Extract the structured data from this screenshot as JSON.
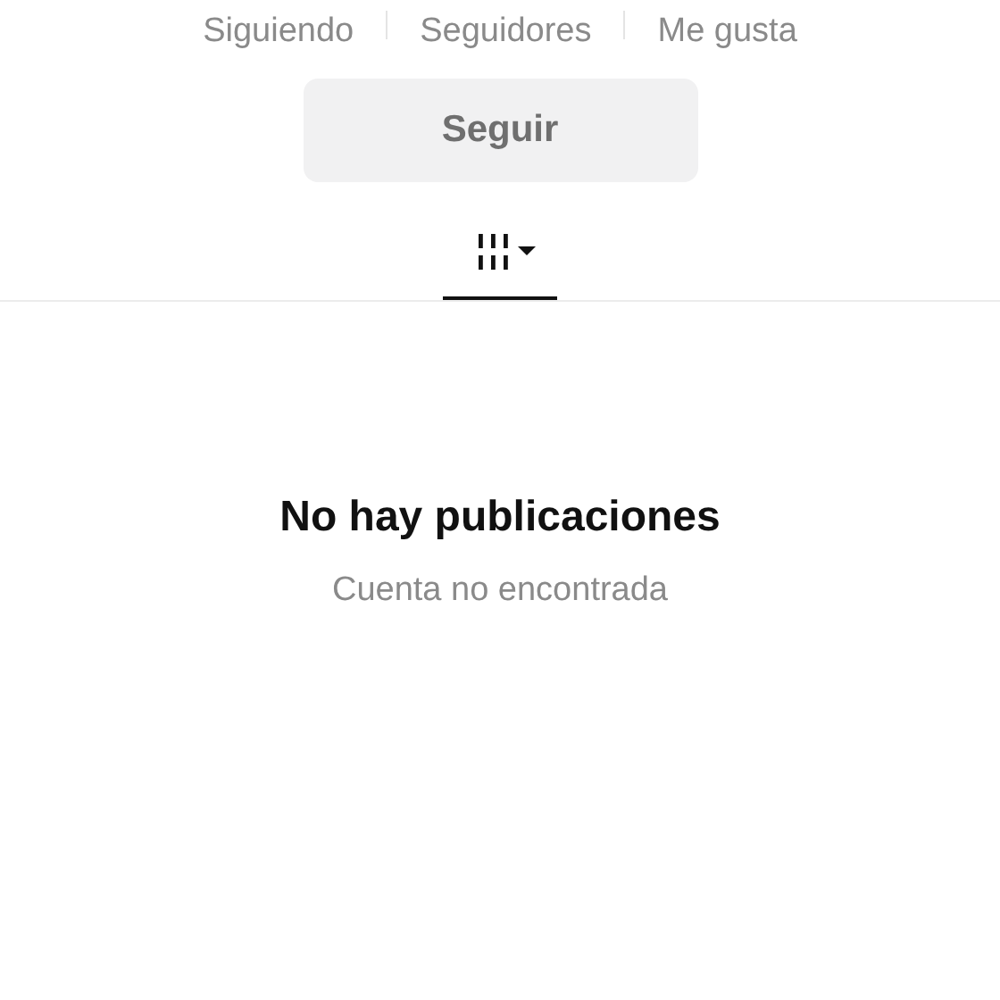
{
  "stats": [
    {
      "label": "Siguiendo"
    },
    {
      "label": "Seguidores"
    },
    {
      "label": "Me gusta"
    }
  ],
  "follow_button": {
    "label": "Seguir"
  },
  "tabs": [
    {
      "selected": true
    }
  ],
  "empty_state": {
    "title": "No hay publicaciones",
    "subtitle": "Cuenta no encontrada"
  }
}
